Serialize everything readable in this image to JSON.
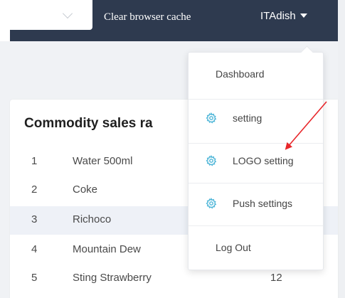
{
  "header": {
    "clear_cache_label": "Clear browser cache",
    "user_name": "ITAdish"
  },
  "ranking": {
    "title": "Commodity sales ra",
    "rows": [
      {
        "rank": "1",
        "name": "Water 500ml",
        "value": ""
      },
      {
        "rank": "2",
        "name": "Coke",
        "value": ""
      },
      {
        "rank": "3",
        "name": "Richoco",
        "value": ""
      },
      {
        "rank": "4",
        "name": "Mountain Dew",
        "value": ""
      },
      {
        "rank": "5",
        "name": "Sting Strawberry",
        "value": "12"
      }
    ]
  },
  "user_dropdown": {
    "items": [
      {
        "label": "Dashboard",
        "icon": ""
      },
      {
        "label": "setting",
        "icon": "gear-icon"
      },
      {
        "label": "LOGO setting",
        "icon": "gear-icon"
      },
      {
        "label": "Push settings",
        "icon": "gear-icon"
      },
      {
        "label": "Log Out",
        "icon": ""
      }
    ]
  },
  "colors": {
    "topbar": "#2e3a4f",
    "gear_icon": "#4fb6d8",
    "annotation_arrow": "#e8262a",
    "row_highlight": "#eef1f7"
  }
}
